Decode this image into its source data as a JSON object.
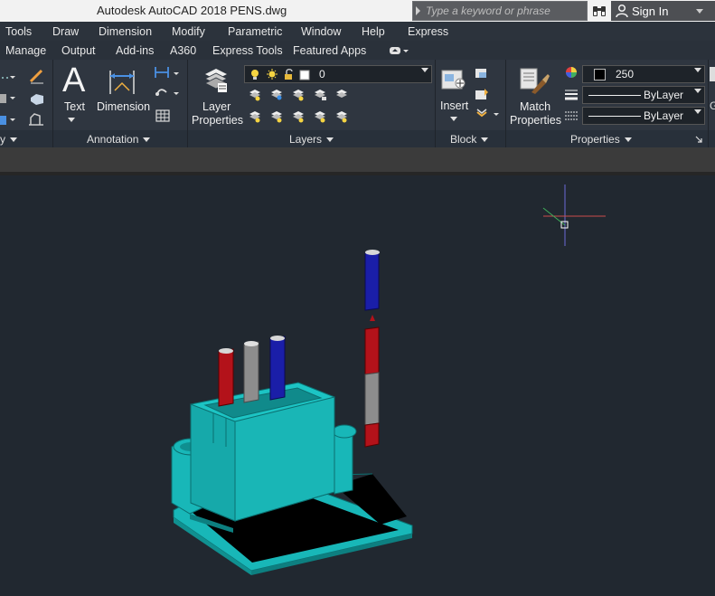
{
  "titlebar": {
    "app_title": "Autodesk AutoCAD 2018    PENS.dwg",
    "search_placeholder": "Type a keyword or phrase",
    "signin_label": "Sign In"
  },
  "menubar": {
    "items": [
      "Tools",
      "Draw",
      "Dimension",
      "Modify",
      "Parametric",
      "Window",
      "Help",
      "Express"
    ]
  },
  "ribbon_tabs": {
    "items": [
      "Manage",
      "Output",
      "Add-ins",
      "A360",
      "Express Tools",
      "Featured Apps"
    ]
  },
  "ribbon": {
    "panels": {
      "partial_left": "y",
      "annotation": "Annotation",
      "layers": "Layers",
      "block": "Block",
      "properties": "Properties"
    },
    "annotation": {
      "text_label": "Text",
      "text_glyph": "A",
      "dimension_label": "Dimension"
    },
    "layers": {
      "layer_properties_line1": "Layer",
      "layer_properties_line2": "Properties",
      "current_layer": "0"
    },
    "block": {
      "insert_label": "Insert"
    },
    "properties": {
      "match_line1": "Match",
      "match_line2": "Properties",
      "color_value": "250",
      "linetype_value": "ByLayer",
      "lineweight_value": "ByLayer",
      "swatch_color": "#000000"
    },
    "right_edge_glyph": "G"
  },
  "colors": {
    "canvas_bg": "#212830",
    "ribbon_bg": "#2f3640",
    "model_teal": "#18b7b8",
    "pen_red": "#b3121a",
    "pen_gray": "#8d8d8d",
    "pen_blue": "#1a1ea8"
  },
  "icons": [
    "binoculars-icon",
    "user-icon",
    "text-icon",
    "dimension-icon",
    "layer-properties-icon",
    "lightbulb-icon",
    "sun-icon",
    "lock-icon",
    "insert-block-icon",
    "match-properties-icon",
    "color-wheel-icon",
    "lineweight-icon",
    "linetype-icon",
    "crosshair-cursor"
  ]
}
